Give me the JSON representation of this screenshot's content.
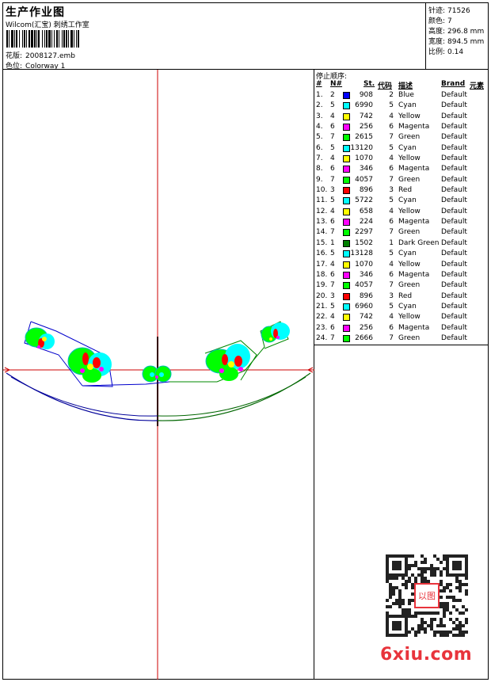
{
  "header": {
    "title": "生产作业图",
    "subtitle": "Wilcom(汇宝) 刺绣工作室",
    "design_label": "花版:",
    "design_value": "2008127.emb",
    "colorway_label": "色位:",
    "colorway_value": "Colorway 1"
  },
  "stats": [
    {
      "label": "针迹:",
      "value": "71526"
    },
    {
      "label": "颜色:",
      "value": "7"
    },
    {
      "label": "高度:",
      "value": "296.8 mm"
    },
    {
      "label": "宽度:",
      "value": "894.5 mm"
    },
    {
      "label": "比例:",
      "value": "0.14"
    }
  ],
  "stop_panel": {
    "title": "停止顺序:",
    "columns": [
      "#",
      "N#",
      "St.",
      "代码",
      "描述",
      "Brand",
      "元素"
    ],
    "rows": [
      {
        "num": "1.",
        "n": "2",
        "color": "#0000ff",
        "st": "908",
        "code": "2",
        "desc": "Blue",
        "brand": "Default"
      },
      {
        "num": "2.",
        "n": "5",
        "color": "#00ffff",
        "st": "6990",
        "code": "5",
        "desc": "Cyan",
        "brand": "Default"
      },
      {
        "num": "3.",
        "n": "4",
        "color": "#ffff00",
        "st": "742",
        "code": "4",
        "desc": "Yellow",
        "brand": "Default"
      },
      {
        "num": "4.",
        "n": "6",
        "color": "#ff00ff",
        "st": "256",
        "code": "6",
        "desc": "Magenta",
        "brand": "Default"
      },
      {
        "num": "5.",
        "n": "7",
        "color": "#00ff00",
        "st": "2615",
        "code": "7",
        "desc": "Green",
        "brand": "Default"
      },
      {
        "num": "6.",
        "n": "5",
        "color": "#00ffff",
        "st": "13120",
        "code": "5",
        "desc": "Cyan",
        "brand": "Default"
      },
      {
        "num": "7.",
        "n": "4",
        "color": "#ffff00",
        "st": "1070",
        "code": "4",
        "desc": "Yellow",
        "brand": "Default"
      },
      {
        "num": "8.",
        "n": "6",
        "color": "#ff00ff",
        "st": "346",
        "code": "6",
        "desc": "Magenta",
        "brand": "Default"
      },
      {
        "num": "9.",
        "n": "7",
        "color": "#00ff00",
        "st": "4057",
        "code": "7",
        "desc": "Green",
        "brand": "Default"
      },
      {
        "num": "10.",
        "n": "3",
        "color": "#ff0000",
        "st": "896",
        "code": "3",
        "desc": "Red",
        "brand": "Default"
      },
      {
        "num": "11.",
        "n": "5",
        "color": "#00ffff",
        "st": "5722",
        "code": "5",
        "desc": "Cyan",
        "brand": "Default"
      },
      {
        "num": "12.",
        "n": "4",
        "color": "#ffff00",
        "st": "658",
        "code": "4",
        "desc": "Yellow",
        "brand": "Default"
      },
      {
        "num": "13.",
        "n": "6",
        "color": "#ff00ff",
        "st": "224",
        "code": "6",
        "desc": "Magenta",
        "brand": "Default"
      },
      {
        "num": "14.",
        "n": "7",
        "color": "#00ff00",
        "st": "2297",
        "code": "7",
        "desc": "Green",
        "brand": "Default"
      },
      {
        "num": "15.",
        "n": "1",
        "color": "#008000",
        "st": "1502",
        "code": "1",
        "desc": "Dark Green",
        "brand": "Default"
      },
      {
        "num": "16.",
        "n": "5",
        "color": "#00ffff",
        "st": "13128",
        "code": "5",
        "desc": "Cyan",
        "brand": "Default"
      },
      {
        "num": "17.",
        "n": "4",
        "color": "#ffff00",
        "st": "1070",
        "code": "4",
        "desc": "Yellow",
        "brand": "Default"
      },
      {
        "num": "18.",
        "n": "6",
        "color": "#ff00ff",
        "st": "346",
        "code": "6",
        "desc": "Magenta",
        "brand": "Default"
      },
      {
        "num": "19.",
        "n": "7",
        "color": "#00ff00",
        "st": "4057",
        "code": "7",
        "desc": "Green",
        "brand": "Default"
      },
      {
        "num": "20.",
        "n": "3",
        "color": "#ff0000",
        "st": "896",
        "code": "3",
        "desc": "Red",
        "brand": "Default"
      },
      {
        "num": "21.",
        "n": "5",
        "color": "#00ffff",
        "st": "6960",
        "code": "5",
        "desc": "Cyan",
        "brand": "Default"
      },
      {
        "num": "22.",
        "n": "4",
        "color": "#ffff00",
        "st": "742",
        "code": "4",
        "desc": "Yellow",
        "brand": "Default"
      },
      {
        "num": "23.",
        "n": "6",
        "color": "#ff00ff",
        "st": "256",
        "code": "6",
        "desc": "Magenta",
        "brand": "Default"
      },
      {
        "num": "24.",
        "n": "7",
        "color": "#00ff00",
        "st": "2666",
        "code": "7",
        "desc": "Green",
        "brand": "Default"
      }
    ]
  },
  "watermark": {
    "text": "6xiu.com",
    "color": "#e8343c"
  },
  "qr_seal_text": "以图",
  "colors": {
    "axis": "#cc0000",
    "outline_blue": "#0000cc",
    "outline_green": "#008800"
  }
}
